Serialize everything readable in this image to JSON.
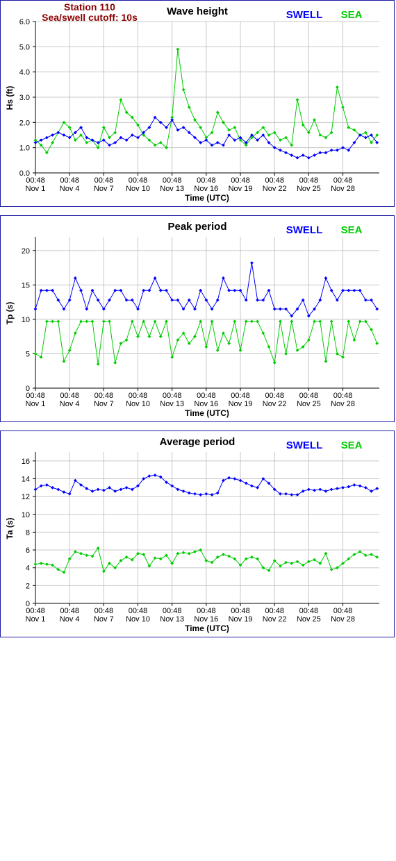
{
  "header": {
    "station": "Station 110",
    "cutoff": "Sea/swell cutoff: 10s"
  },
  "colors": {
    "swell": "#0000ff",
    "sea": "#00cc00",
    "grid": "#c8c8c8",
    "plot_bg": "#ffffff",
    "frame": "#1a1aa0",
    "header_text": "#8b0000"
  },
  "legend": {
    "swell": "SWELL",
    "sea": "SEA"
  },
  "x_ticks": [
    {
      "time": "00:48",
      "date": "Nov 1"
    },
    {
      "time": "00:48",
      "date": "Nov 4"
    },
    {
      "time": "00:48",
      "date": "Nov 7"
    },
    {
      "time": "00:48",
      "date": "Nov 10"
    },
    {
      "time": "00:48",
      "date": "Nov 13"
    },
    {
      "time": "00:48",
      "date": "Nov 16"
    },
    {
      "time": "00:48",
      "date": "Nov 19"
    },
    {
      "time": "00:48",
      "date": "Nov 22"
    },
    {
      "time": "00:48",
      "date": "Nov 25"
    },
    {
      "time": "00:48",
      "date": "Nov 28"
    }
  ],
  "chart_data": [
    {
      "type": "line",
      "title": "Wave height",
      "xlabel": "Time (UTC)",
      "ylabel": "Hs (ft)",
      "xlim": [
        1,
        31.2
      ],
      "ylim": [
        0,
        6
      ],
      "yticks": [
        "0.0",
        "1.0",
        "2.0",
        "3.0",
        "4.0",
        "5.0",
        "6.0"
      ],
      "grid": true,
      "legend_position": "top-right",
      "series": [
        {
          "name": "SWELL",
          "x": [
            1,
            1.5,
            2,
            2.5,
            3,
            3.5,
            4,
            4.5,
            5,
            5.5,
            6,
            6.5,
            7,
            7.5,
            8,
            8.5,
            9,
            9.5,
            10,
            10.5,
            11,
            11.5,
            12,
            12.5,
            13,
            13.5,
            14,
            14.5,
            15,
            15.5,
            16,
            16.5,
            17,
            17.5,
            18,
            18.5,
            19,
            19.5,
            20,
            20.5,
            21,
            21.5,
            22,
            22.5,
            23,
            23.5,
            24,
            24.5,
            25,
            25.5,
            26,
            26.5,
            27,
            27.5,
            28,
            28.5,
            29,
            29.5,
            30,
            30.5,
            31
          ],
          "values": [
            1.2,
            1.3,
            1.4,
            1.5,
            1.6,
            1.5,
            1.4,
            1.6,
            1.8,
            1.4,
            1.3,
            1.2,
            1.3,
            1.1,
            1.2,
            1.4,
            1.3,
            1.5,
            1.4,
            1.6,
            1.8,
            2.2,
            2.0,
            1.8,
            2.1,
            1.7,
            1.8,
            1.6,
            1.4,
            1.2,
            1.3,
            1.1,
            1.2,
            1.1,
            1.5,
            1.3,
            1.4,
            1.2,
            1.5,
            1.3,
            1.5,
            1.2,
            1.0,
            0.9,
            0.8,
            0.7,
            0.6,
            0.7,
            0.6,
            0.7,
            0.8,
            0.8,
            0.9,
            0.9,
            1.0,
            0.9,
            1.2,
            1.5,
            1.4,
            1.5,
            1.2
          ]
        },
        {
          "name": "SEA",
          "x": [
            1,
            1.5,
            2,
            2.5,
            3,
            3.5,
            4,
            4.5,
            5,
            5.5,
            6,
            6.5,
            7,
            7.5,
            8,
            8.5,
            9,
            9.5,
            10,
            10.5,
            11,
            11.5,
            12,
            12.5,
            13,
            13.5,
            14,
            14.5,
            15,
            15.5,
            16,
            16.5,
            17,
            17.5,
            18,
            18.5,
            19,
            19.5,
            20,
            20.5,
            21,
            21.5,
            22,
            22.5,
            23,
            23.5,
            24,
            24.5,
            25,
            25.5,
            26,
            26.5,
            27,
            27.5,
            28,
            28.5,
            29,
            29.5,
            30,
            30.5,
            31
          ],
          "values": [
            1.3,
            1.1,
            0.8,
            1.2,
            1.6,
            2.0,
            1.8,
            1.3,
            1.5,
            1.2,
            1.3,
            1.0,
            1.8,
            1.4,
            1.6,
            2.9,
            2.4,
            2.2,
            1.9,
            1.5,
            1.3,
            1.1,
            1.2,
            1.0,
            2.2,
            4.9,
            3.3,
            2.6,
            2.1,
            1.8,
            1.4,
            1.6,
            2.4,
            2.0,
            1.7,
            1.8,
            1.3,
            1.1,
            1.4,
            1.6,
            1.8,
            1.5,
            1.6,
            1.3,
            1.4,
            1.1,
            2.9,
            1.9,
            1.6,
            2.1,
            1.5,
            1.4,
            1.6,
            3.4,
            2.6,
            1.8,
            1.7,
            1.5,
            1.6,
            1.2,
            1.5
          ]
        }
      ]
    },
    {
      "type": "line",
      "title": "Peak period",
      "xlabel": "Time (UTC)",
      "ylabel": "Tp (s)",
      "xlim": [
        1,
        31.2
      ],
      "ylim": [
        0,
        22
      ],
      "yticks": [
        "0",
        "5",
        "10",
        "15",
        "20"
      ],
      "grid": true,
      "legend_position": "top-right",
      "series": [
        {
          "name": "SWELL",
          "x": [
            1,
            1.5,
            2,
            2.5,
            3,
            3.5,
            4,
            4.5,
            5,
            5.5,
            6,
            6.5,
            7,
            7.5,
            8,
            8.5,
            9,
            9.5,
            10,
            10.5,
            11,
            11.5,
            12,
            12.5,
            13,
            13.5,
            14,
            14.5,
            15,
            15.5,
            16,
            16.5,
            17,
            17.5,
            18,
            18.5,
            19,
            19.5,
            20,
            20.5,
            21,
            21.5,
            22,
            22.5,
            23,
            23.5,
            24,
            24.5,
            25,
            25.5,
            26,
            26.5,
            27,
            27.5,
            28,
            28.5,
            29,
            29.5,
            30,
            30.5,
            31
          ],
          "values": [
            11.5,
            14.2,
            14.2,
            14.2,
            12.8,
            11.5,
            12.8,
            16.0,
            14.2,
            11.5,
            14.2,
            12.8,
            11.5,
            12.8,
            14.2,
            14.2,
            12.8,
            12.8,
            11.5,
            14.2,
            14.2,
            16.0,
            14.2,
            14.2,
            12.8,
            12.8,
            11.5,
            12.8,
            11.5,
            14.2,
            12.8,
            11.5,
            12.8,
            16.0,
            14.2,
            14.2,
            14.2,
            12.8,
            18.2,
            12.8,
            12.8,
            14.2,
            11.5,
            11.5,
            11.5,
            10.5,
            11.5,
            12.8,
            10.5,
            11.5,
            12.8,
            16.0,
            14.2,
            12.8,
            14.2,
            14.2,
            14.2,
            14.2,
            12.8,
            12.8,
            11.5
          ]
        },
        {
          "name": "SEA",
          "x": [
            1,
            1.5,
            2,
            2.5,
            3,
            3.5,
            4,
            4.5,
            5,
            5.5,
            6,
            6.5,
            7,
            7.5,
            8,
            8.5,
            9,
            9.5,
            10,
            10.5,
            11,
            11.5,
            12,
            12.5,
            13,
            13.5,
            14,
            14.5,
            15,
            15.5,
            16,
            16.5,
            17,
            17.5,
            18,
            18.5,
            19,
            19.5,
            20,
            20.5,
            21,
            21.5,
            22,
            22.5,
            23,
            23.5,
            24,
            24.5,
            25,
            25.5,
            26,
            26.5,
            27,
            27.5,
            28,
            28.5,
            29,
            29.5,
            30,
            30.5,
            31
          ],
          "values": [
            5.0,
            4.5,
            9.7,
            9.7,
            9.7,
            3.9,
            5.5,
            8.0,
            9.7,
            9.7,
            9.7,
            3.5,
            9.7,
            9.7,
            3.7,
            6.5,
            7.0,
            9.7,
            7.5,
            9.7,
            7.5,
            9.7,
            7.5,
            9.7,
            4.5,
            7.0,
            8.0,
            6.5,
            7.5,
            9.7,
            6.0,
            9.7,
            5.5,
            8.0,
            6.5,
            9.7,
            5.5,
            9.7,
            9.7,
            9.7,
            8.0,
            6.0,
            3.7,
            9.7,
            5.0,
            9.7,
            5.5,
            6.0,
            7.0,
            9.7,
            9.7,
            3.9,
            9.7,
            5.0,
            4.5,
            9.7,
            7.0,
            9.7,
            9.7,
            8.5,
            6.5
          ]
        }
      ]
    },
    {
      "type": "line",
      "title": "Average period",
      "xlabel": "Time (UTC)",
      "ylabel": "Ta (s)",
      "xlim": [
        1,
        31.2
      ],
      "ylim": [
        0,
        17
      ],
      "yticks": [
        "0",
        "2",
        "4",
        "6",
        "8",
        "10",
        "12",
        "14",
        "16"
      ],
      "grid": true,
      "legend_position": "top-right",
      "series": [
        {
          "name": "SWELL",
          "x": [
            1,
            1.5,
            2,
            2.5,
            3,
            3.5,
            4,
            4.5,
            5,
            5.5,
            6,
            6.5,
            7,
            7.5,
            8,
            8.5,
            9,
            9.5,
            10,
            10.5,
            11,
            11.5,
            12,
            12.5,
            13,
            13.5,
            14,
            14.5,
            15,
            15.5,
            16,
            16.5,
            17,
            17.5,
            18,
            18.5,
            19,
            19.5,
            20,
            20.5,
            21,
            21.5,
            22,
            22.5,
            23,
            23.5,
            24,
            24.5,
            25,
            25.5,
            26,
            26.5,
            27,
            27.5,
            28,
            28.5,
            29,
            29.5,
            30,
            30.5,
            31
          ],
          "values": [
            12.8,
            13.2,
            13.3,
            13.0,
            12.8,
            12.5,
            12.3,
            13.8,
            13.3,
            12.9,
            12.6,
            12.8,
            12.7,
            13.0,
            12.6,
            12.8,
            13.0,
            12.8,
            13.2,
            14.0,
            14.3,
            14.4,
            14.2,
            13.6,
            13.2,
            12.8,
            12.6,
            12.4,
            12.3,
            12.2,
            12.3,
            12.2,
            12.4,
            13.8,
            14.1,
            14.0,
            13.8,
            13.5,
            13.2,
            13.0,
            14.0,
            13.5,
            12.8,
            12.3,
            12.3,
            12.2,
            12.2,
            12.6,
            12.8,
            12.7,
            12.8,
            12.6,
            12.8,
            12.9,
            13.0,
            13.1,
            13.3,
            13.2,
            13.0,
            12.6,
            12.9
          ]
        },
        {
          "name": "SEA",
          "x": [
            1,
            1.5,
            2,
            2.5,
            3,
            3.5,
            4,
            4.5,
            5,
            5.5,
            6,
            6.5,
            7,
            7.5,
            8,
            8.5,
            9,
            9.5,
            10,
            10.5,
            11,
            11.5,
            12,
            12.5,
            13,
            13.5,
            14,
            14.5,
            15,
            15.5,
            16,
            16.5,
            17,
            17.5,
            18,
            18.5,
            19,
            19.5,
            20,
            20.5,
            21,
            21.5,
            22,
            22.5,
            23,
            23.5,
            24,
            24.5,
            25,
            25.5,
            26,
            26.5,
            27,
            27.5,
            28,
            28.5,
            29,
            29.5,
            30,
            30.5,
            31
          ],
          "values": [
            4.4,
            4.5,
            4.4,
            4.3,
            3.8,
            3.5,
            5.0,
            5.8,
            5.6,
            5.4,
            5.3,
            6.2,
            3.6,
            4.5,
            4.0,
            4.8,
            5.2,
            4.9,
            5.6,
            5.5,
            4.2,
            5.1,
            5.0,
            5.4,
            4.5,
            5.6,
            5.7,
            5.6,
            5.8,
            6.0,
            4.8,
            4.6,
            5.2,
            5.5,
            5.3,
            5.0,
            4.3,
            5.0,
            5.2,
            5.0,
            4.0,
            3.7,
            4.8,
            4.2,
            4.6,
            4.5,
            4.7,
            4.3,
            4.7,
            4.9,
            4.5,
            5.6,
            3.8,
            4.0,
            4.5,
            5.0,
            5.5,
            5.8,
            5.4,
            5.5,
            5.2
          ]
        }
      ]
    }
  ]
}
